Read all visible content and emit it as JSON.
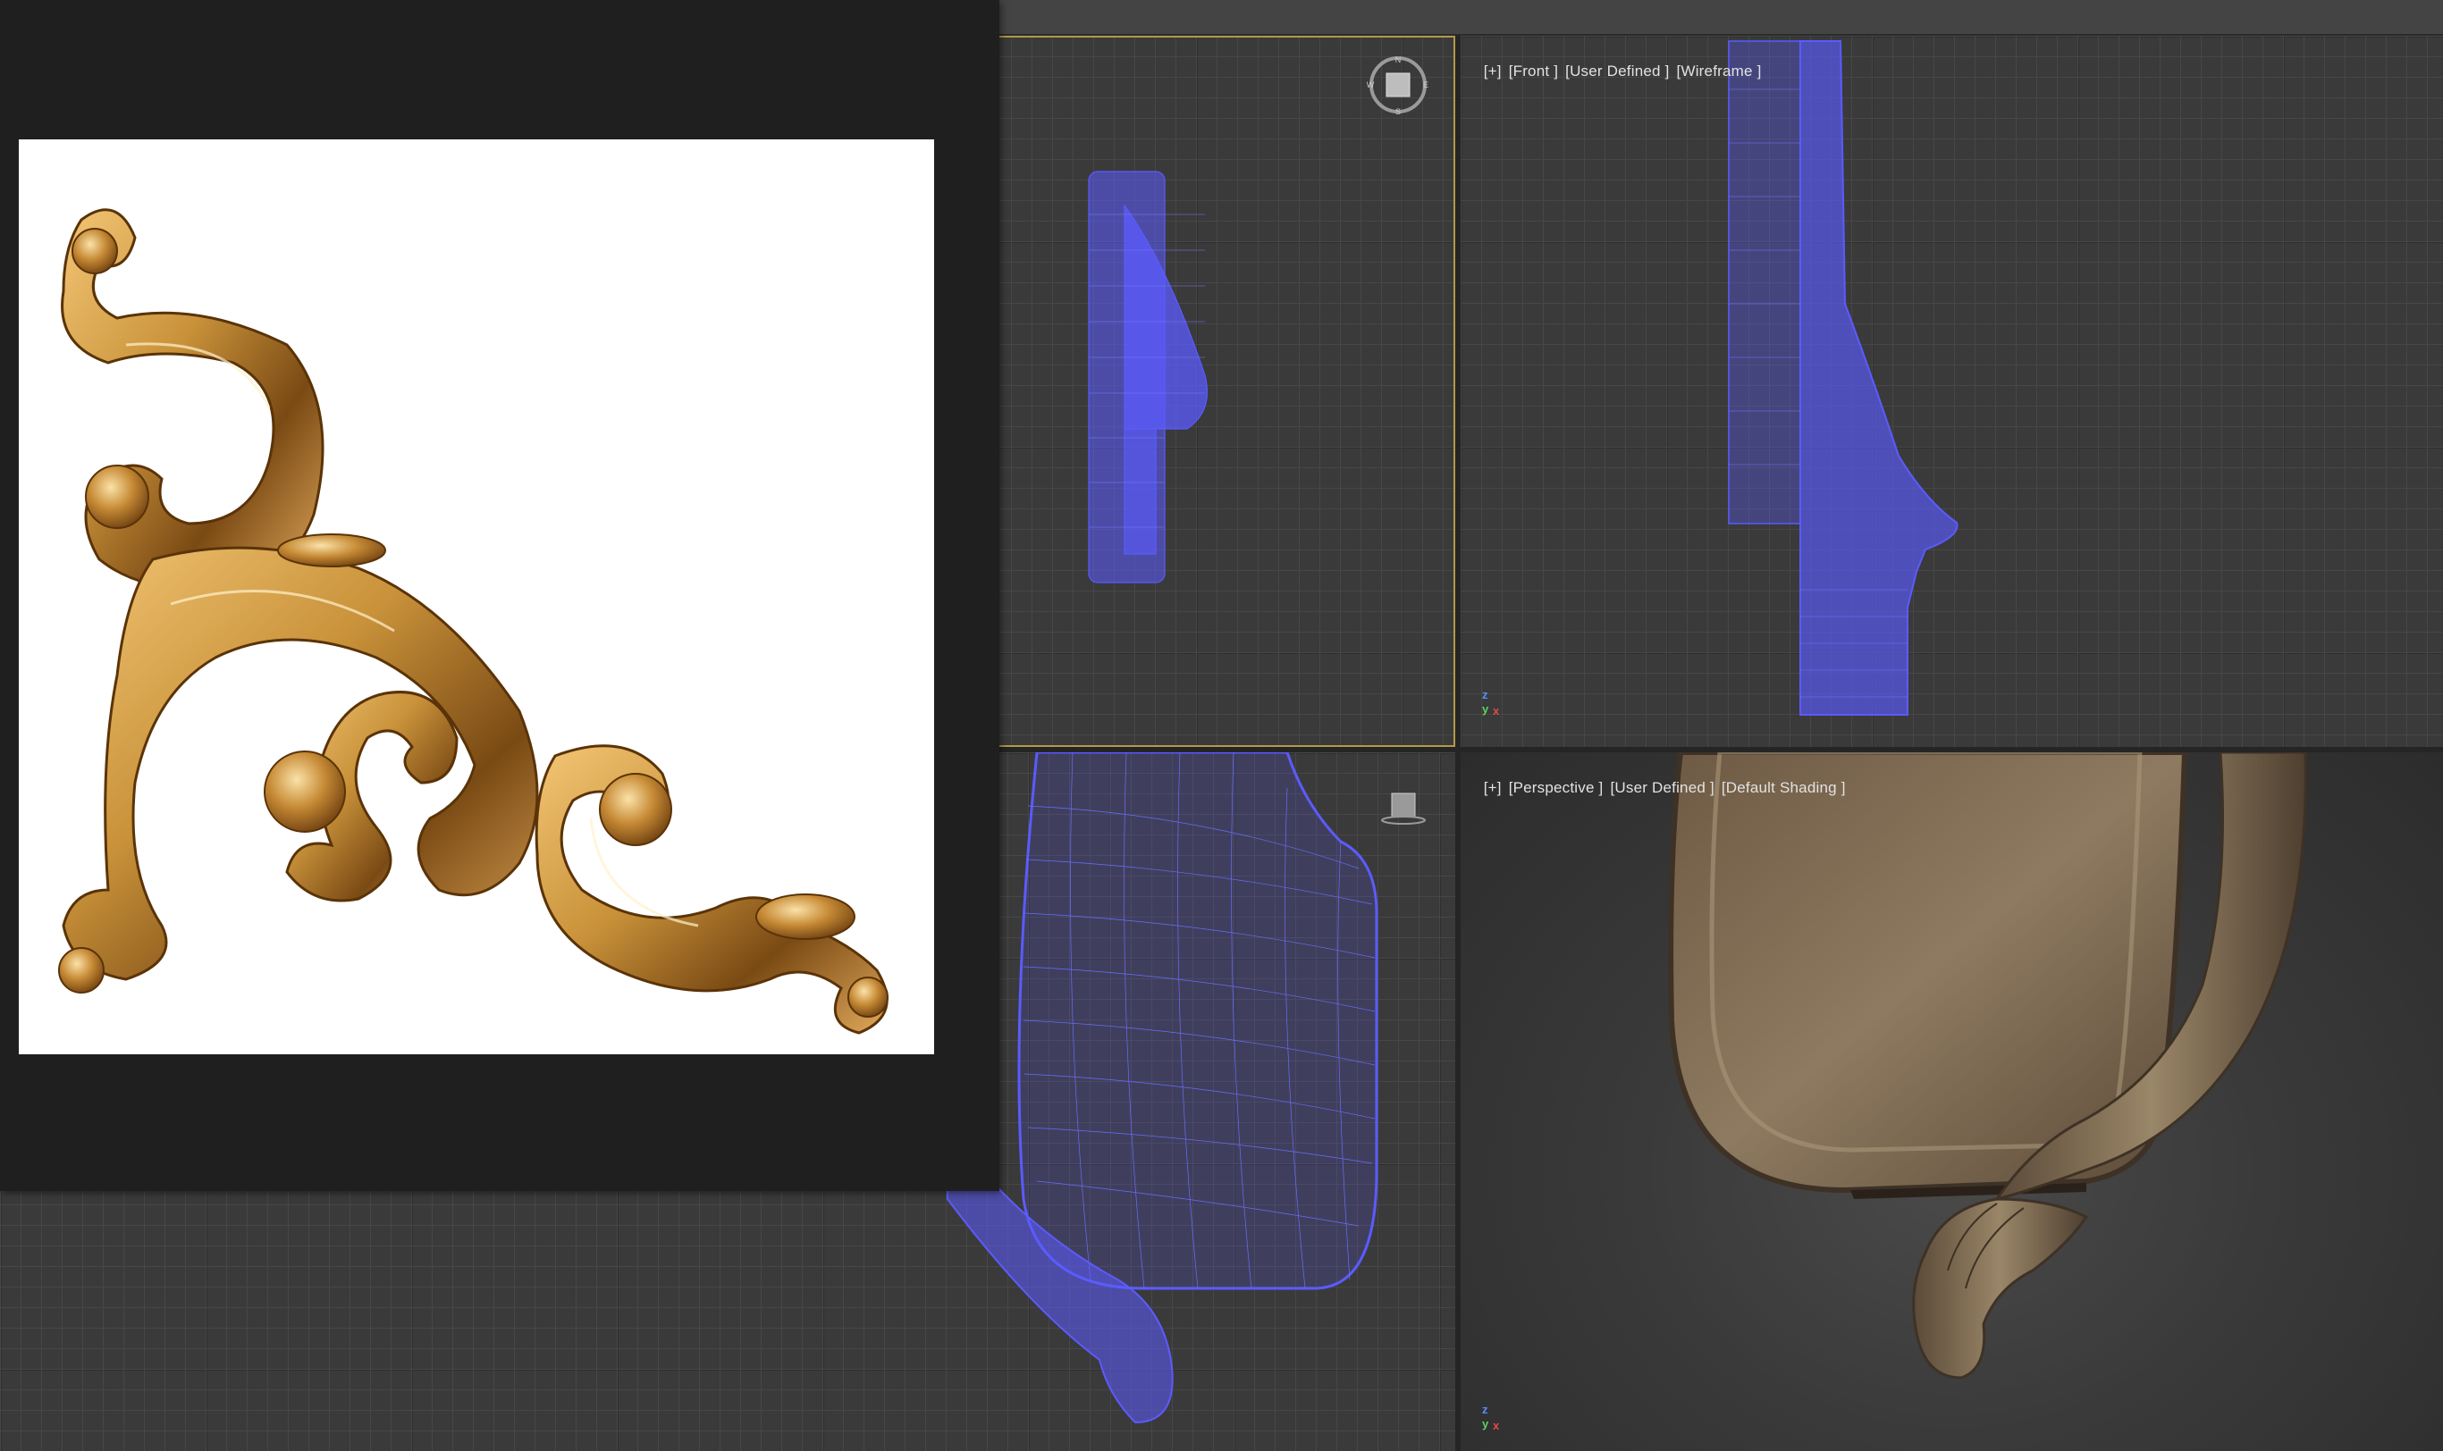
{
  "viewports": {
    "front": {
      "plus": "[+]",
      "view": "[Front ]",
      "style": "[User Defined ]",
      "shading": "[Wireframe ]"
    },
    "perspective": {
      "plus": "[+]",
      "view": "[Perspective ]",
      "style": "[User Defined ]",
      "shading": "[Default Shading ]"
    }
  },
  "compass": {
    "n": "N",
    "s": "S",
    "e": "E",
    "w": "W"
  },
  "axis_gizmo": {
    "x": "x",
    "y": "y",
    "z": "z"
  },
  "colors": {
    "wireframe": "#5b5bff",
    "wood": "#8b7355",
    "gold": "#c9923a",
    "grid_bg": "#3a3a3a",
    "active_border": "#b39a4a"
  }
}
